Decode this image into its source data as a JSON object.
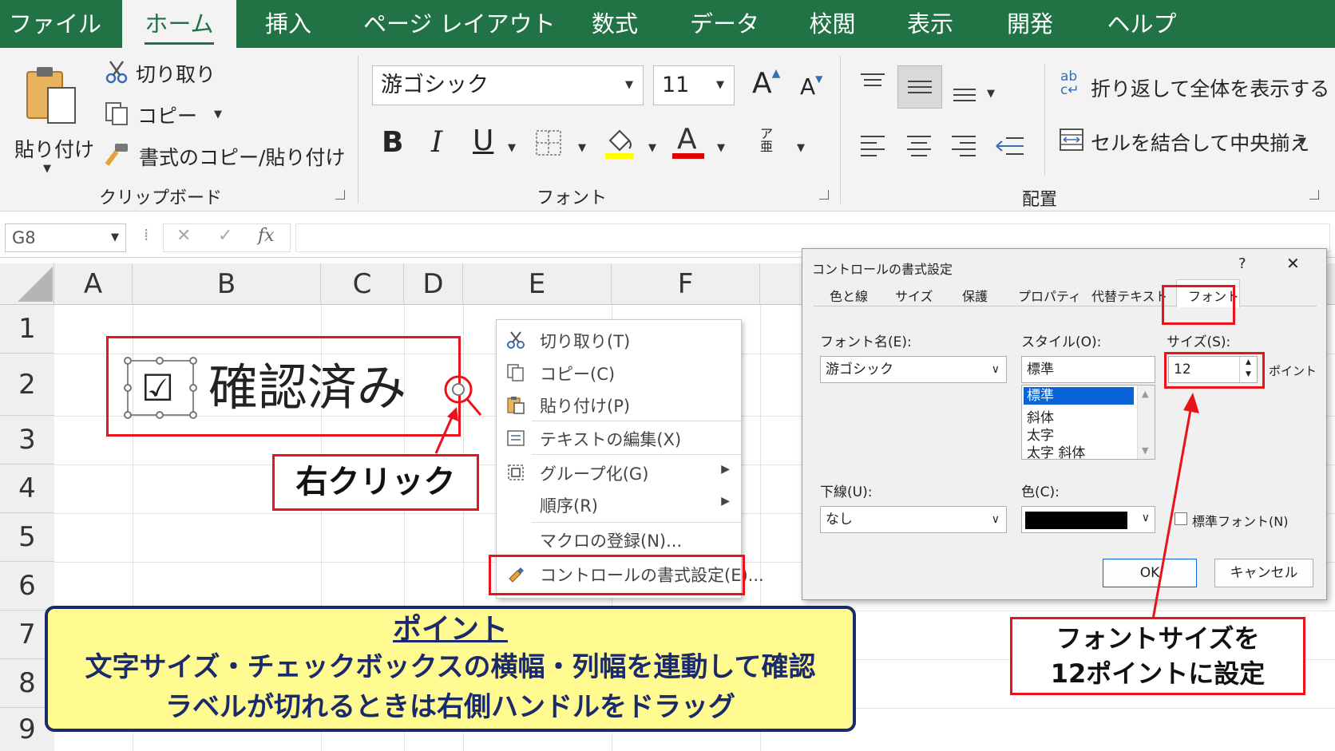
{
  "ribbon_tabs": [
    "ファイル",
    "ホーム",
    "挿入",
    "ページ レイアウト",
    "数式",
    "データ",
    "校閲",
    "表示",
    "開発",
    "ヘルプ"
  ],
  "clipboard": {
    "paste": "貼り付け",
    "cut": "切り取り",
    "copy": "コピー",
    "format_painter": "書式のコピー/貼り付け",
    "group": "クリップボード"
  },
  "font": {
    "font_name": "游ゴシック",
    "font_size": "11",
    "bold": "B",
    "italic": "I",
    "underline": "U",
    "font_color_glyph": "A",
    "grow": "A",
    "shrink": "A",
    "group": "フォント"
  },
  "alignment": {
    "wrap_text": "折り返して全体を表示する",
    "merge_center": "セルを結合して中央揃え",
    "group": "配置"
  },
  "formula_bar": {
    "name_box": "G8",
    "fx": "fx"
  },
  "columns": [
    "A",
    "B",
    "C",
    "D",
    "E",
    "F"
  ],
  "rows": [
    "1",
    "2",
    "3",
    "4",
    "5",
    "6",
    "7",
    "8",
    "9"
  ],
  "checkbox_label": "確認済み",
  "right_click_label": "右クリック",
  "context_menu": {
    "cut": "切り取り(T)",
    "copy": "コピー(C)",
    "paste": "貼り付け(P)",
    "edit_text": "テキストの編集(X)",
    "group": "グループ化(G)",
    "order": "順序(R)",
    "assign_macro": "マクロの登録(N)...",
    "format_control": "コントロールの書式設定(E)..."
  },
  "dialog": {
    "title": "コントロールの書式設定",
    "help": "?",
    "close": "✕",
    "tabs": [
      "色と線",
      "サイズ",
      "保護",
      "プロパティ",
      "代替テキスト",
      "フォント"
    ],
    "font_name_label": "フォント名(E):",
    "font_name_value": "游ゴシック",
    "style_label": "スタイル(O):",
    "style_value": "標準",
    "style_options": [
      "標準",
      "斜体",
      "太字",
      "太字 斜体"
    ],
    "size_label": "サイズ(S):",
    "size_value": "12",
    "size_unit": "ポイント",
    "underline_label": "下線(U):",
    "underline_value": "なし",
    "color_label": "色(C):",
    "color_value": "#000000",
    "normal_font": "標準フォント(N)",
    "ok": "OK",
    "cancel": "キャンセル"
  },
  "callout_font_size": [
    "フォントサイズを",
    "12ポイントに設定"
  ],
  "point": {
    "title": "ポイント",
    "line1": "文字サイズ・チェックボックスの横幅・列幅を連動して確認",
    "line2": "ラベルが切れるときは右側ハンドルをドラッグ"
  },
  "colors": {
    "excel_green": "#217346",
    "highlight_red": "#e8141a",
    "point_bg": "#fffb90",
    "point_border": "#1b2a6b"
  }
}
